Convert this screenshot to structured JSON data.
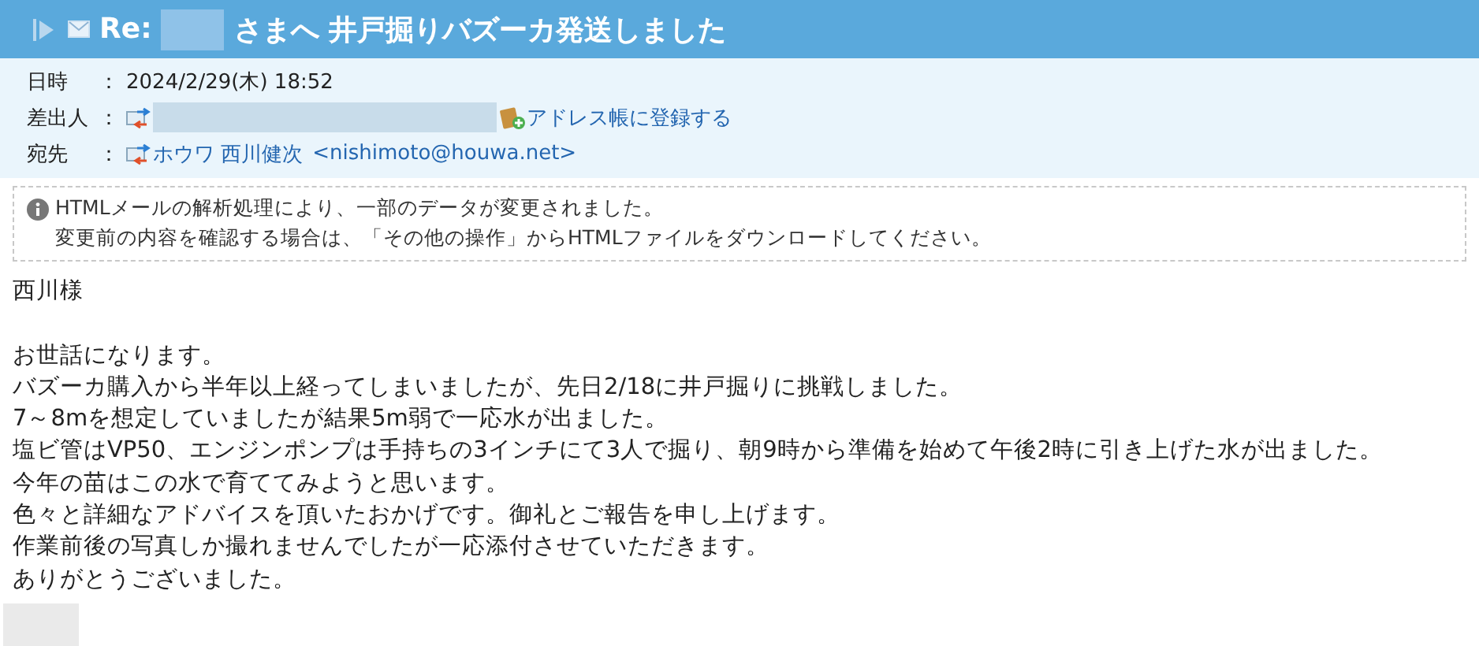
{
  "header": {
    "prefix": "Re:",
    "subject": "さまへ 井戸掘りバズーカ発送しました"
  },
  "meta": [
    {
      "kind": "date",
      "label": "日時",
      "value": "2024/2/29(木) 18:52"
    },
    {
      "kind": "sender",
      "label": "差出人",
      "link": "アドレス帳に登録する"
    },
    {
      "kind": "recipient",
      "label": "宛先",
      "name": "ホウワ 西川健次",
      "address": "<nishimoto@houwa.net>"
    }
  ],
  "separator": "：",
  "notice": [
    "HTMLメールの解析処理により、一部のデータが変更されました。",
    "変更前の内容を確認する場合は、「その他の操作」からHTMLファイルをダウンロードしてください。"
  ],
  "body": [
    [
      "西川様"
    ],
    [
      "お世話になります。",
      "バズーカ購入から半年以上経ってしまいましたが、先日2/18に井戸掘りに挑戦しました。",
      "7～8mを想定していましたが結果5m弱で一応水が出ました。",
      "塩ビ管はVP50、エンジンポンプは手持ちの3インチにて3人で掘り、朝9時から準備を始めて午後2時に引き上げた水が出ました。",
      "今年の苗はこの水で育ててみようと思います。",
      "色々と詳細なアドバイスを頂いたおかげです。御礼とご報告を申し上げます。",
      "作業前後の写真しか撮れませんでしたが一応添付させていただきます。",
      "ありがとうございました。"
    ]
  ]
}
